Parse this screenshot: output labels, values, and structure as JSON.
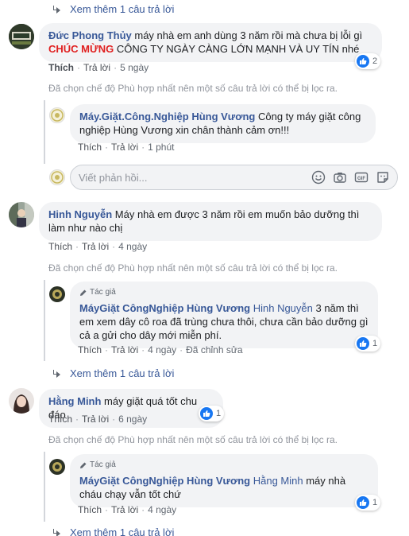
{
  "comments": [
    {
      "more_replies": "Xem thêm 1 câu trả lời"
    },
    {
      "author": "Đức Phong Thủy",
      "text_before": " máy nhà em anh dùng 3 năm rồi mà chưa bị lỗi gì",
      "highlight": "CHÚC MỪNG",
      "text_after": " CÔNG TY NGÀY CÀNG LỚN MẠNH VÀ UY TÍN nhé",
      "like": "Thích",
      "reply": "Trả lời",
      "time": "5 ngày",
      "reactions": "2",
      "filter_note": "Đã chọn chế độ Phù hợp nhất nên một số câu trả lời có thể bị lọc ra.",
      "replies": [
        {
          "author": "Máy.Giặt.Công.Nghiệp Hùng Vương",
          "text": " Công ty máy giặt công nghiệp Hùng Vương xin chân thành cảm ơn!!!",
          "like": "Thích",
          "reply": "Trả lời",
          "time": "1 phút"
        }
      ],
      "reply_box": {
        "placeholder": "Viết phản hồi..."
      }
    },
    {
      "author": "Hinh Nguyễn",
      "text": " Máy nhà em được 3 năm rồi em muốn bảo dưỡng thì làm như nào chị",
      "like": "Thích",
      "reply": "Trả lời",
      "time": "4 ngày",
      "filter_note": "Đã chọn chế độ Phù hợp nhất nên một số câu trả lời có thể bị lọc ra.",
      "replies": [
        {
          "author_tag": "Tác giả",
          "author": "MáyGiặt CôngNghiệp Hùng Vương",
          "mention": "Hinh Nguyễn",
          "text": " 3 năm thì em xem dây cô roa đã trùng chưa thôi, chưa cần bảo dưỡng gì cả a gửi cho dây mới miễn phí.",
          "like": "Thích",
          "reply": "Trả lời",
          "time": "4 ngày",
          "edited": "Đã chỉnh sửa",
          "reactions": "1"
        }
      ],
      "more_replies": "Xem thêm 1 câu trả lời"
    },
    {
      "author": "Hằng Minh",
      "text": " máy giặt quá tốt chu đáo",
      "like": "Thích",
      "reply": "Trả lời",
      "time": "6 ngày",
      "reactions": "1",
      "filter_note": "Đã chọn chế độ Phù hợp nhất nên một số câu trả lời có thể bị lọc ra.",
      "replies": [
        {
          "author_tag": "Tác giả",
          "author": "MáyGiặt CôngNghiệp Hùng Vương",
          "mention": "Hằng Minh",
          "text": " máy nhà cháu chạy vẫn tốt chứ",
          "like": "Thích",
          "reply": "Trả lời",
          "time": "4 ngày",
          "reactions": "1"
        }
      ],
      "more_replies": "Xem thêm 1 câu trả lời"
    }
  ],
  "colors": {
    "link": "#385898",
    "bubble": "#f2f3f5",
    "like_blue": "#1877f2",
    "highlight_red": "#e02020"
  }
}
